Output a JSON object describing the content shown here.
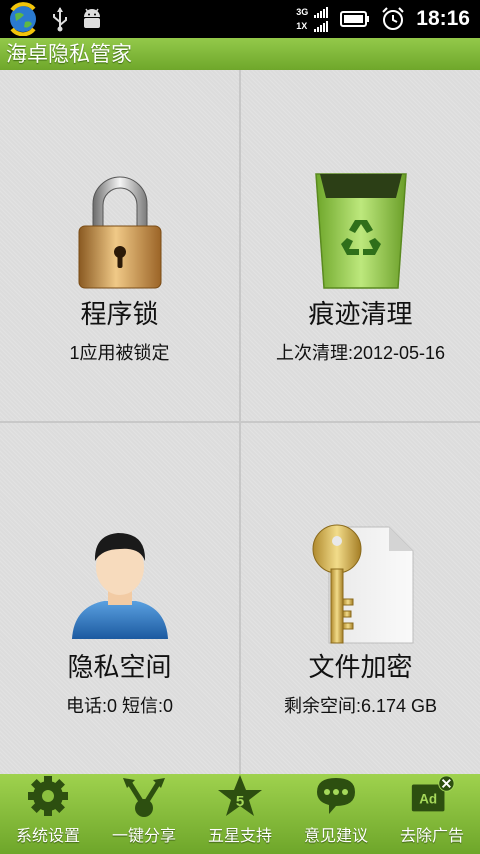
{
  "status_bar": {
    "network_label_top": "3G",
    "network_label_bottom": "1X",
    "time": "18:16"
  },
  "app": {
    "title": "海卓隐私管家"
  },
  "tiles": [
    {
      "title": "程序锁",
      "subtitle": "1应用被锁定",
      "icon": "padlock-icon"
    },
    {
      "title": "痕迹清理",
      "subtitle": "上次清理:2012-05-16",
      "icon": "recycle-bin-icon"
    },
    {
      "title": "隐私空间",
      "subtitle": "电话:0 短信:0",
      "icon": "person-icon"
    },
    {
      "title": "文件加密",
      "subtitle": "剩余空间:6.174 GB",
      "icon": "key-file-icon"
    }
  ],
  "bottom_nav": [
    {
      "label": "系统设置",
      "icon": "gear-icon"
    },
    {
      "label": "一键分享",
      "icon": "share-icon"
    },
    {
      "label": "五星支持",
      "icon": "star-icon",
      "badge": "5"
    },
    {
      "label": "意见建议",
      "icon": "chat-bubble-icon"
    },
    {
      "label": "去除广告",
      "icon": "remove-ad-icon",
      "badge": "Ad"
    }
  ],
  "colors": {
    "accent_green": "#7ab432",
    "status_bar": "#000000",
    "tile_bg": "#dcdcdc"
  }
}
